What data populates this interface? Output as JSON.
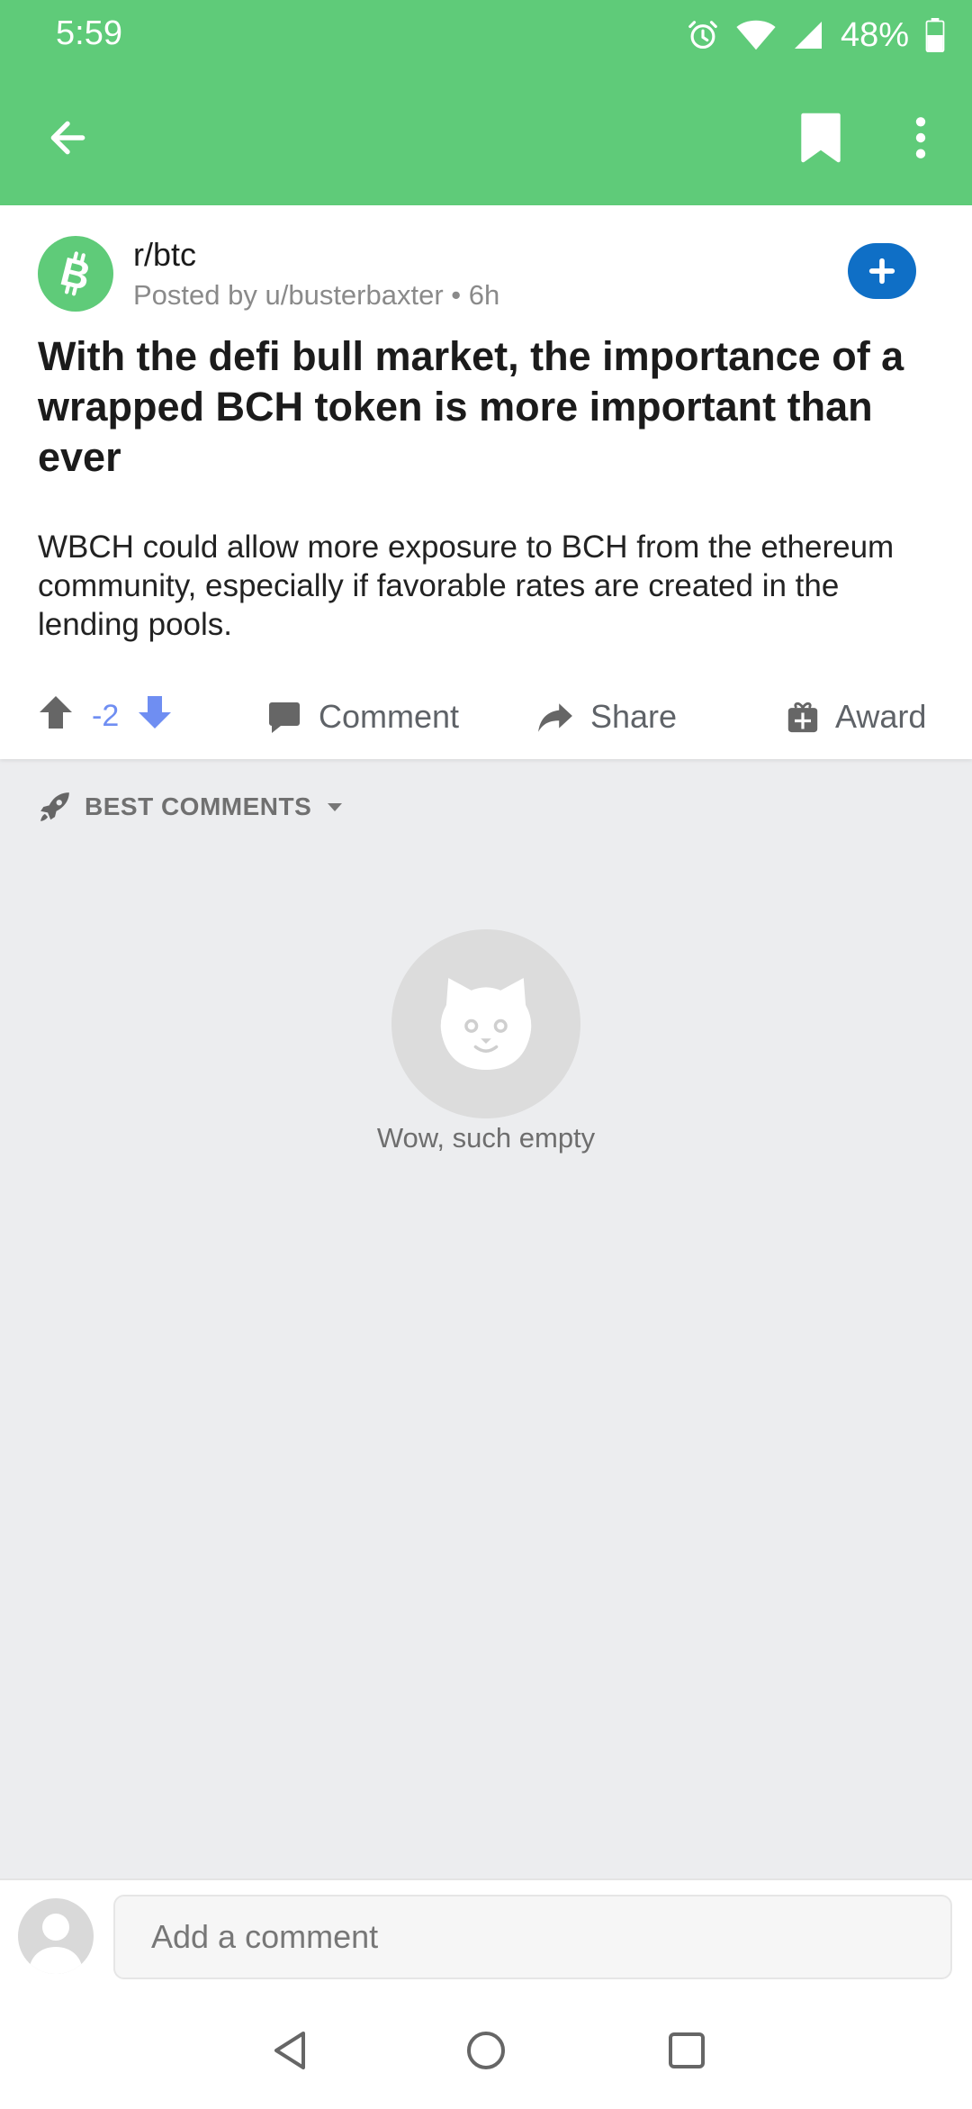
{
  "status_bar": {
    "time": "5:59",
    "battery": "48%",
    "icons": [
      "alarm-icon",
      "wifi-icon",
      "cell-signal-icon",
      "battery-icon"
    ]
  },
  "app_bar": {
    "icons": [
      "back-arrow-icon",
      "bookmark-icon",
      "more-vert-icon"
    ],
    "color": "#5fcb79"
  },
  "post": {
    "subreddit": "r/btc",
    "meta": "Posted by u/busterbaxter • 6h",
    "title": "With the defi bull market, the importance of a wrapped BCH token is more important than ever",
    "body": "WBCH could allow more exposure to BCH from the ethereum community, especially if favorable rates are created in the lending pools.",
    "votes": "-2",
    "actions": {
      "comment": "Comment",
      "share": "Share",
      "award": "Award"
    },
    "join_icon": "plus-icon"
  },
  "comments": {
    "sort_label": "BEST COMMENTS",
    "empty_text": "Wow, such empty"
  },
  "comment_bar": {
    "placeholder": "Add a comment"
  },
  "colors": {
    "accent": "#5fcb79",
    "join_button": "#0f6fc6",
    "downvote": "#6f8ef2"
  }
}
